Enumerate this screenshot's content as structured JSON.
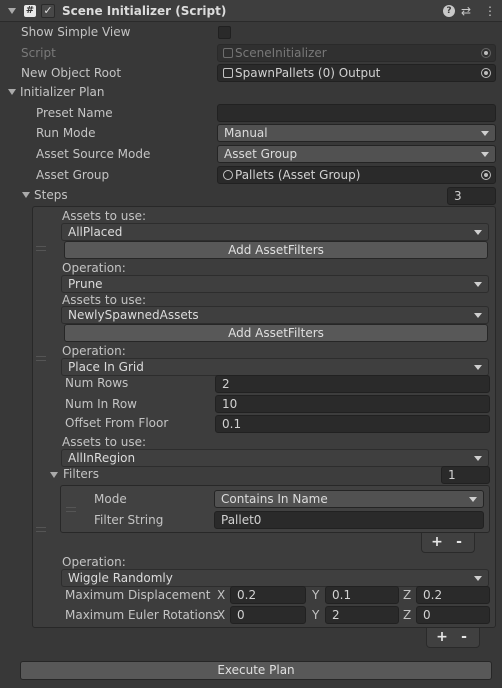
{
  "header": {
    "title": "Scene Initializer (Script)",
    "script_icon": "#",
    "icons": [
      "question-icon",
      "sliders-icon",
      "kebab-menu-icon"
    ]
  },
  "fields": {
    "show_simple_view": "Show Simple View",
    "script_label": "Script",
    "script_value": "SceneInitializer",
    "new_object_root_label": "New Object Root",
    "new_object_root_value": "SpawnPallets (0) Output"
  },
  "plan": {
    "section": "Initializer Plan",
    "preset_name_label": "Preset Name",
    "preset_name_value": "",
    "run_mode_label": "Run Mode",
    "run_mode_value": "Manual",
    "asset_source_mode_label": "Asset Source Mode",
    "asset_source_mode_value": "Asset Group",
    "asset_group_label": "Asset Group",
    "asset_group_value": "Pallets (Asset Group)",
    "steps_label": "Steps",
    "steps_count": "3"
  },
  "steps": [
    {
      "assets_label": "Assets to use:",
      "assets_value": "AllPlaced",
      "add_filters": "Add AssetFilters",
      "operation_label": "Operation:",
      "operation_value": "Prune"
    },
    {
      "assets_label": "Assets to use:",
      "assets_value": "NewlySpawnedAssets",
      "add_filters": "Add AssetFilters",
      "operation_label": "Operation:",
      "operation_value": "Place In Grid",
      "num_rows_label": "Num Rows",
      "num_rows_value": "2",
      "num_in_row_label": "Num In Row",
      "num_in_row_value": "10",
      "offset_label": "Offset From Floor",
      "offset_value": "0.1"
    },
    {
      "assets_label": "Assets to use:",
      "assets_value": "AllInRegion",
      "filters_label": "Filters",
      "filters_count": "1",
      "mode_label": "Mode",
      "mode_value": "Contains In Name",
      "filter_string_label": "Filter String",
      "filter_string_value": "Pallet0",
      "operation_label": "Operation:",
      "operation_value": "Wiggle Randomly",
      "max_disp_label": "Maximum Displacement",
      "max_disp": {
        "x": "0.2",
        "y": "0.1",
        "z": "0.2"
      },
      "max_euler_label": "Maximum Euler Rotations",
      "max_euler": {
        "x": "0",
        "y": "2",
        "z": "0"
      }
    }
  ],
  "axis_labels": {
    "x": "X",
    "y": "Y",
    "z": "Z"
  },
  "list_buttons": {
    "plus": "+",
    "minus": "-"
  },
  "execute_button": "Execute Plan"
}
